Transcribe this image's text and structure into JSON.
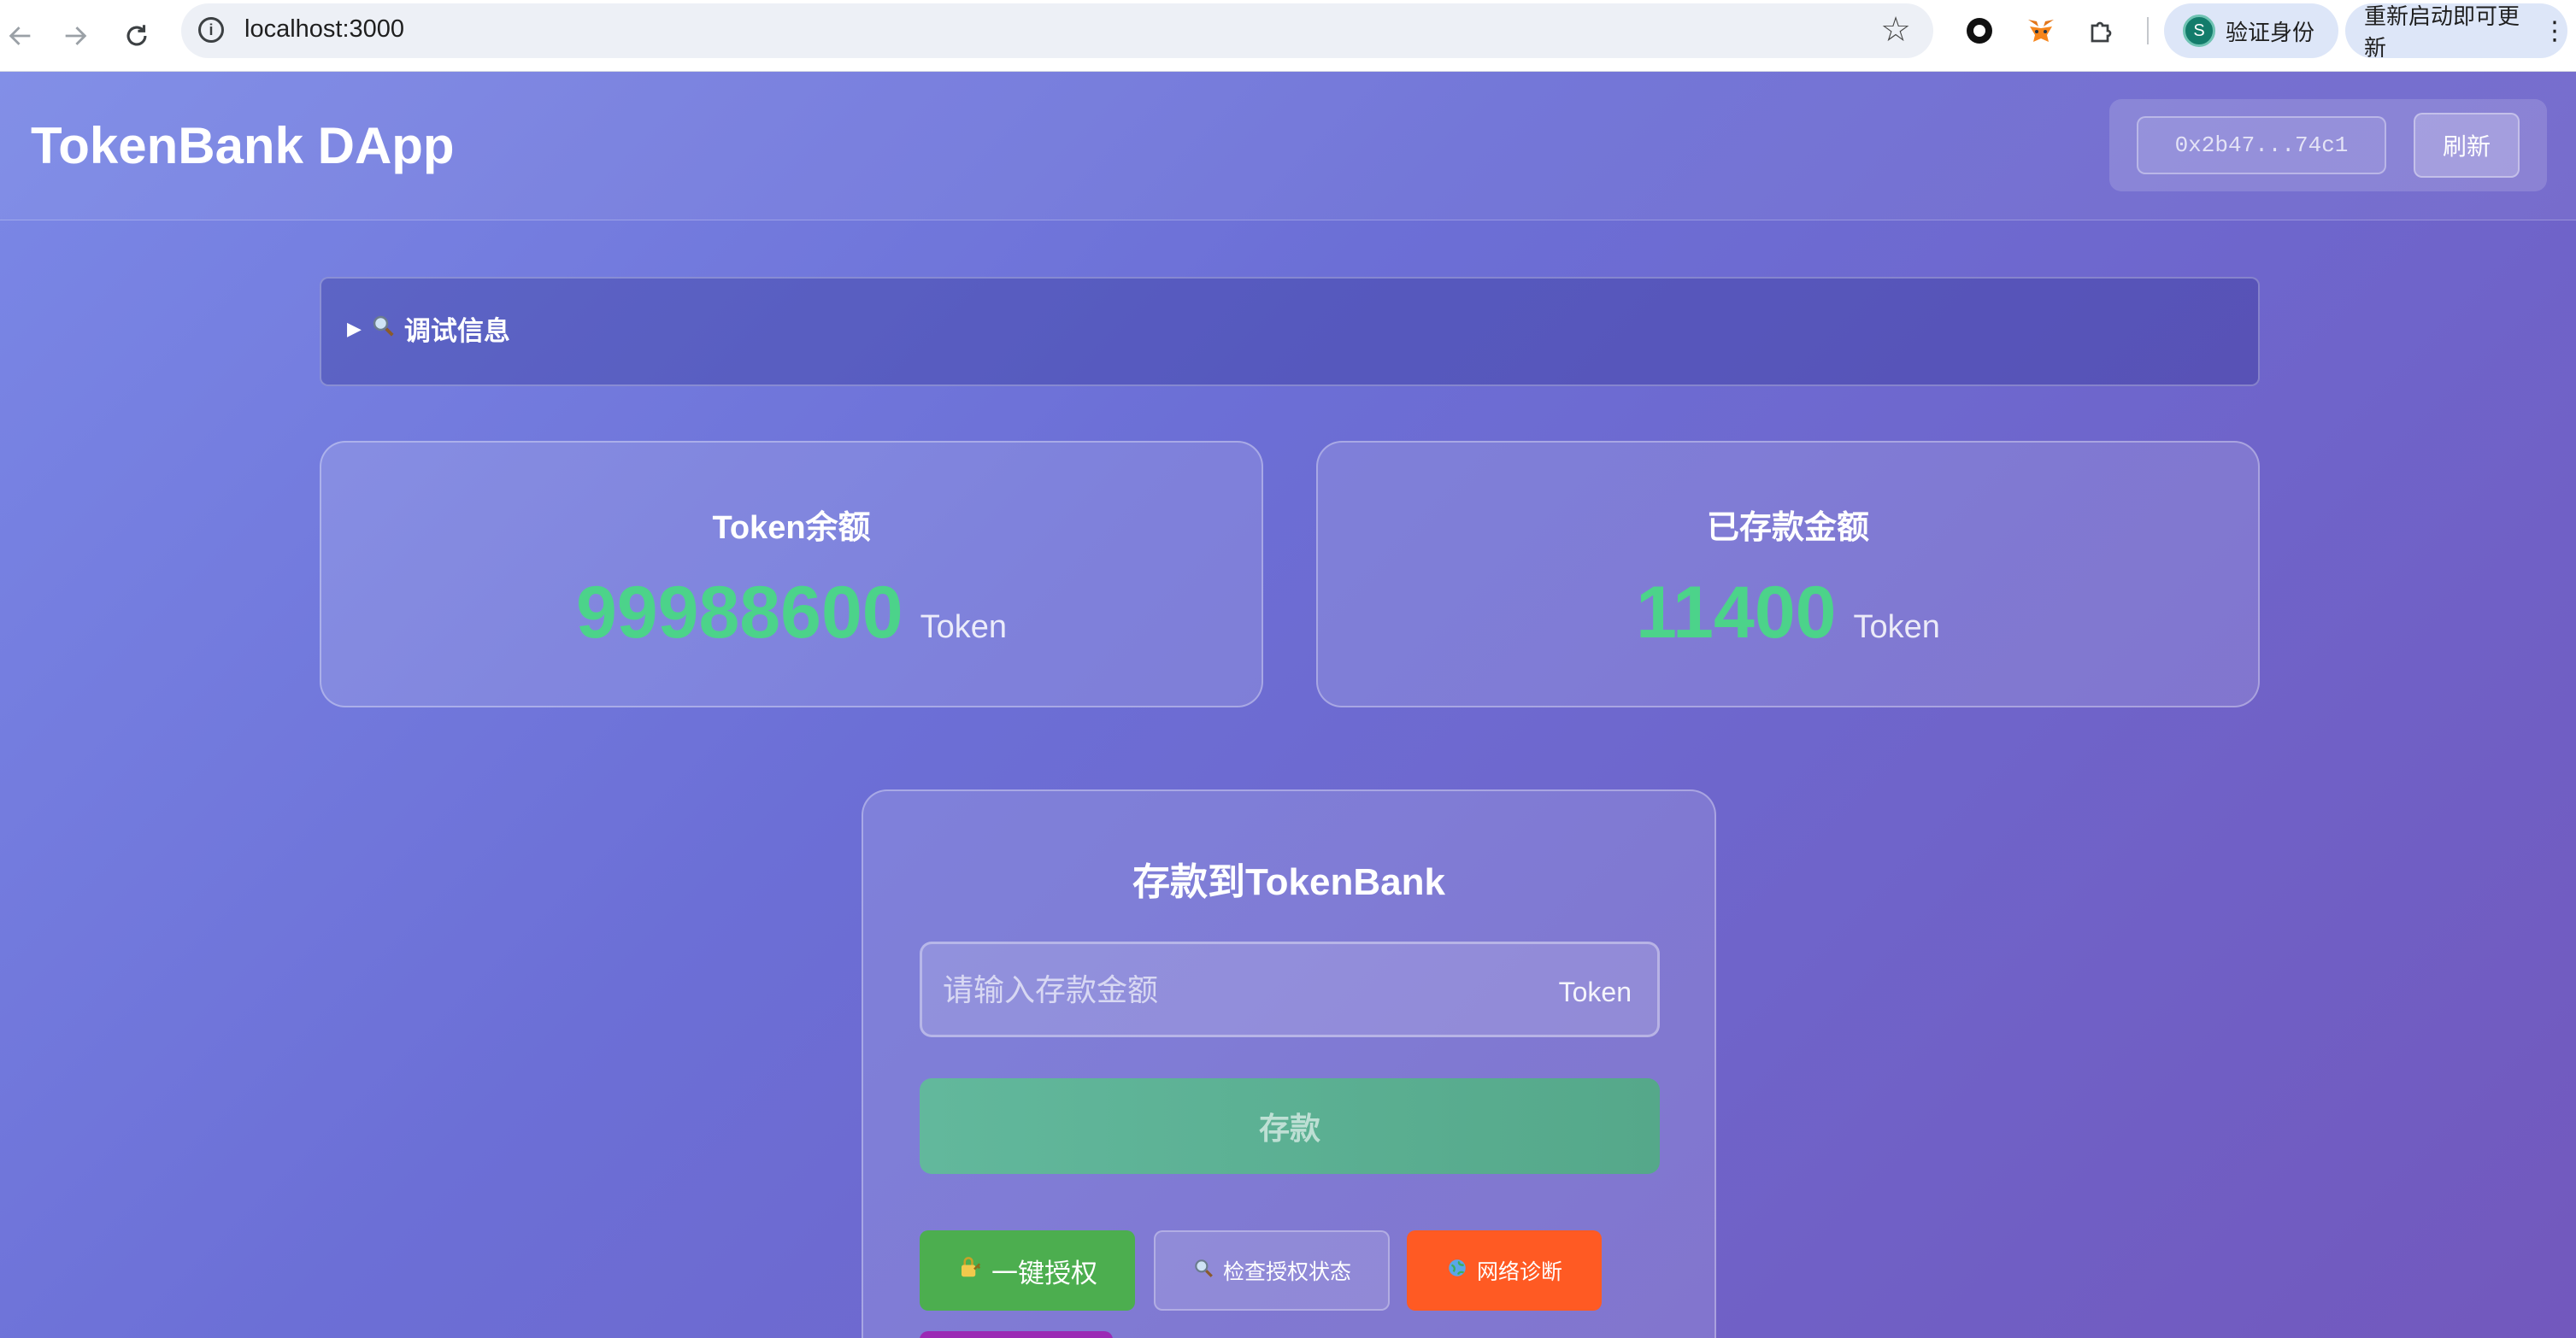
{
  "browser": {
    "url": "localhost:3000",
    "verify_label": "验证身份",
    "verify_initial": "S",
    "update_label": "重新启动即可更新"
  },
  "header": {
    "title": "TokenBank DApp",
    "address": "0x2b47...74c1",
    "refresh_label": "刷新"
  },
  "debug": {
    "label": "调试信息"
  },
  "cards": {
    "token_balance": {
      "title": "Token余额",
      "value": "99988600",
      "unit": "Token"
    },
    "deposited": {
      "title": "已存款金额",
      "value": "11400",
      "unit": "Token"
    }
  },
  "deposit": {
    "title": "存款到TokenBank",
    "placeholder": "请输入存款金额",
    "unit": "Token",
    "submit_label": "存款"
  },
  "actions": {
    "authorize_label": "一键授权",
    "check_label": "检查授权状态",
    "network_label": "网络诊断"
  },
  "colors": {
    "amount_green": "#4cd38a",
    "authorize_green": "#4cae4f",
    "network_orange": "#ff5a23",
    "extra_purple": "#9b2ab5"
  }
}
